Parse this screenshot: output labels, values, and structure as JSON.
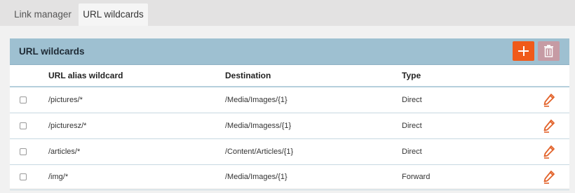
{
  "tabs": [
    {
      "label": "Link manager",
      "active": false
    },
    {
      "label": "URL wildcards",
      "active": true
    }
  ],
  "panel": {
    "title": "URL wildcards",
    "add_icon": "plus-icon",
    "delete_icon": "trash-icon"
  },
  "table": {
    "columns": [
      "URL alias wildcard",
      "Destination",
      "Type"
    ],
    "rows": [
      {
        "alias": "/pictures/*",
        "destination": "/Media/Images/{1}",
        "type": "Direct"
      },
      {
        "alias": "/picturesz/*",
        "destination": "/Media/Imagess/{1}",
        "type": "Direct"
      },
      {
        "alias": "/articles/*",
        "destination": "/Content/Articles/{1}",
        "type": "Direct"
      },
      {
        "alias": "/img/*",
        "destination": "/Media/Images/{1}",
        "type": "Forward"
      }
    ]
  },
  "colors": {
    "header_bg": "#9ec0d1",
    "add_button": "#f05a1a",
    "delete_button": "#c69ba4",
    "edit_icon": "#e2632b"
  }
}
